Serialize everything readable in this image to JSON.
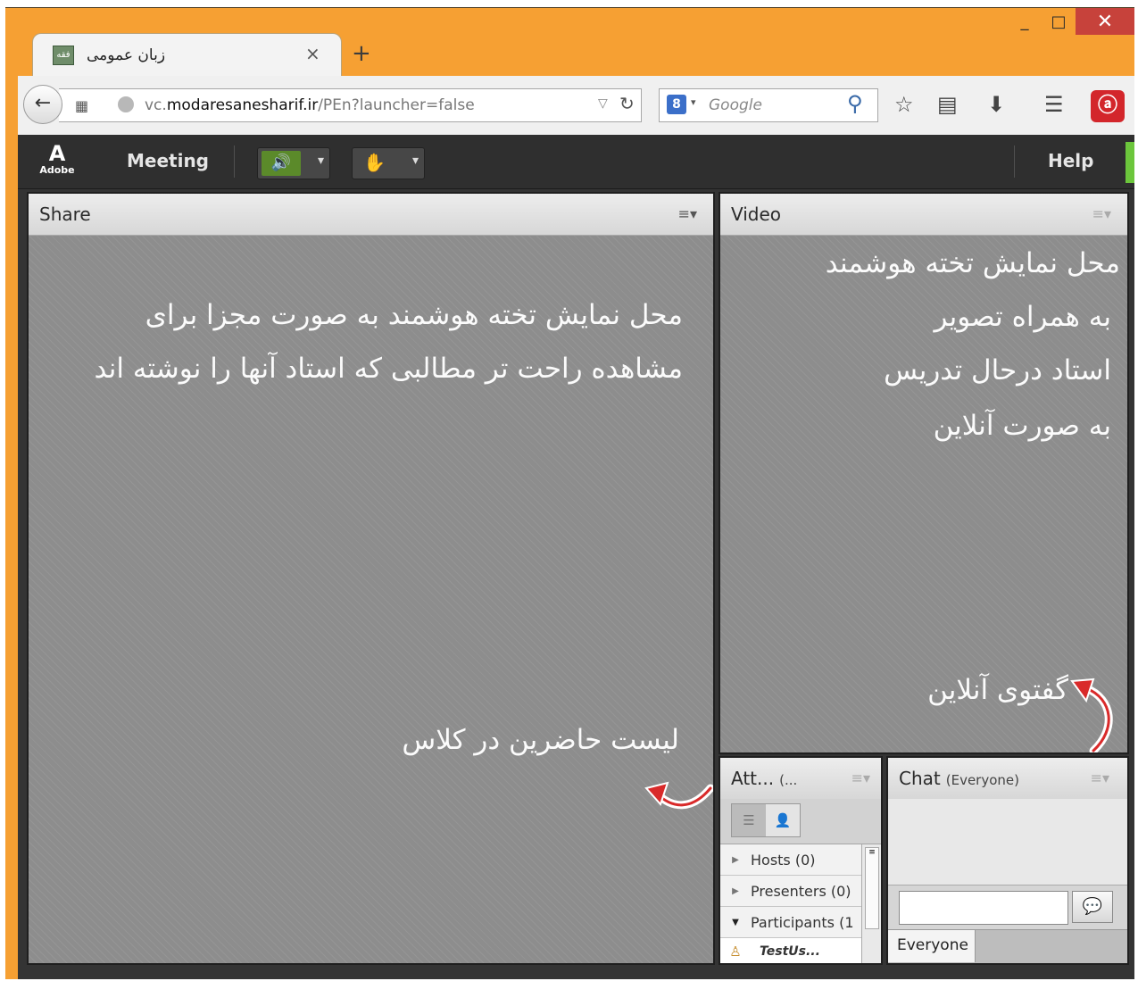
{
  "browser": {
    "tab_title": "زبان عمومی",
    "tab_icon_text": "فقه",
    "url_prefix": "vc.",
    "url_domain": "modaresanesharif.ir",
    "url_path": "/PEn?launcher=false",
    "search_placeholder": "Google",
    "search_engine_letter": "8",
    "window_buttons": {
      "minimize": "_",
      "maximize": "□",
      "close": "✕"
    },
    "icons": [
      "back-arrow-icon",
      "tab-grid-icon",
      "globe-icon",
      "reload-icon",
      "search-magnifier-icon",
      "bookmark-star-icon",
      "reading-list-icon",
      "download-icon",
      "hamburger-menu-icon",
      "avira-icon"
    ]
  },
  "meeting": {
    "logo_text": "Adobe",
    "menu_meeting": "Meeting",
    "menu_help": "Help",
    "status_color": "#6cc63c"
  },
  "share_pod": {
    "title": "Share",
    "annotation_lines": [
      "محل نمایش تخته هوشمند به صورت مجزا برای",
      "مشاهده راحت تر مطالبی که استاد آنها را نوشته اند"
    ],
    "attendees_annotation": "لیست حاضرین در کلاس"
  },
  "video_pod": {
    "title": "Video",
    "annotation_lines": [
      "محل نمایش تخته هوشمند",
      "به همراه تصویر",
      "استاد درحال تدریس",
      "به صورت آنلاین"
    ],
    "chat_annotation": "گفتوی آنلاین"
  },
  "attendees_pod": {
    "title": "Att...",
    "count": "(...",
    "rows": [
      {
        "label": "Hosts (0)"
      },
      {
        "label": "Presenters (0)"
      },
      {
        "label": "Participants (1"
      }
    ],
    "user": "TestUs..."
  },
  "chat_pod": {
    "title": "Chat",
    "audience": "(Everyone)",
    "tab": "Everyone"
  },
  "colors": {
    "window_frame": "#f6a033",
    "close_button": "#c7423b",
    "pod_body": "#8d8d8d",
    "annotation_arrow": "#d92a2a"
  }
}
